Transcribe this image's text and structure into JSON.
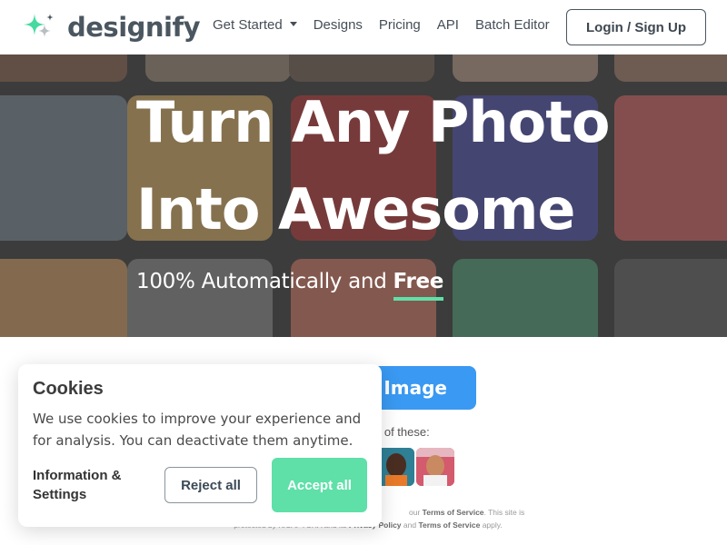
{
  "brand": {
    "name": "designify",
    "accent": "#5ee0a8",
    "primary": "#3a99f2",
    "icon": "sparkle-icon"
  },
  "nav": {
    "items": [
      {
        "label": "Get Started",
        "has_dropdown": true
      },
      {
        "label": "Designs"
      },
      {
        "label": "Pricing"
      },
      {
        "label": "API"
      },
      {
        "label": "Batch Editor"
      }
    ],
    "login_label": "Login / Sign Up"
  },
  "hero": {
    "title_line1": "Turn Any Photo",
    "title_line2": "Into Awesome",
    "subtitle_prefix": "100% Automatically and ",
    "subtitle_highlight": "Free"
  },
  "upload": {
    "label": "Image",
    "try_text": "e of these:"
  },
  "legal": {
    "line1_prefix": "our ",
    "line1_link": "Terms of Service",
    "line1_suffix": ". This site is",
    "line2_prefix": "protected by reCAPTCHA and its ",
    "line2_privacy": "Privacy Policy",
    "line2_and": " and ",
    "line2_terms": "Terms of Service",
    "line2_suffix": " apply."
  },
  "cookie": {
    "title": "Cookies",
    "body": "We use cookies to improve your experience and for analysis. You can deactivate them anytime.",
    "info_label": "Information & Settings",
    "reject_label": "Reject all",
    "accept_label": "Accept all"
  }
}
